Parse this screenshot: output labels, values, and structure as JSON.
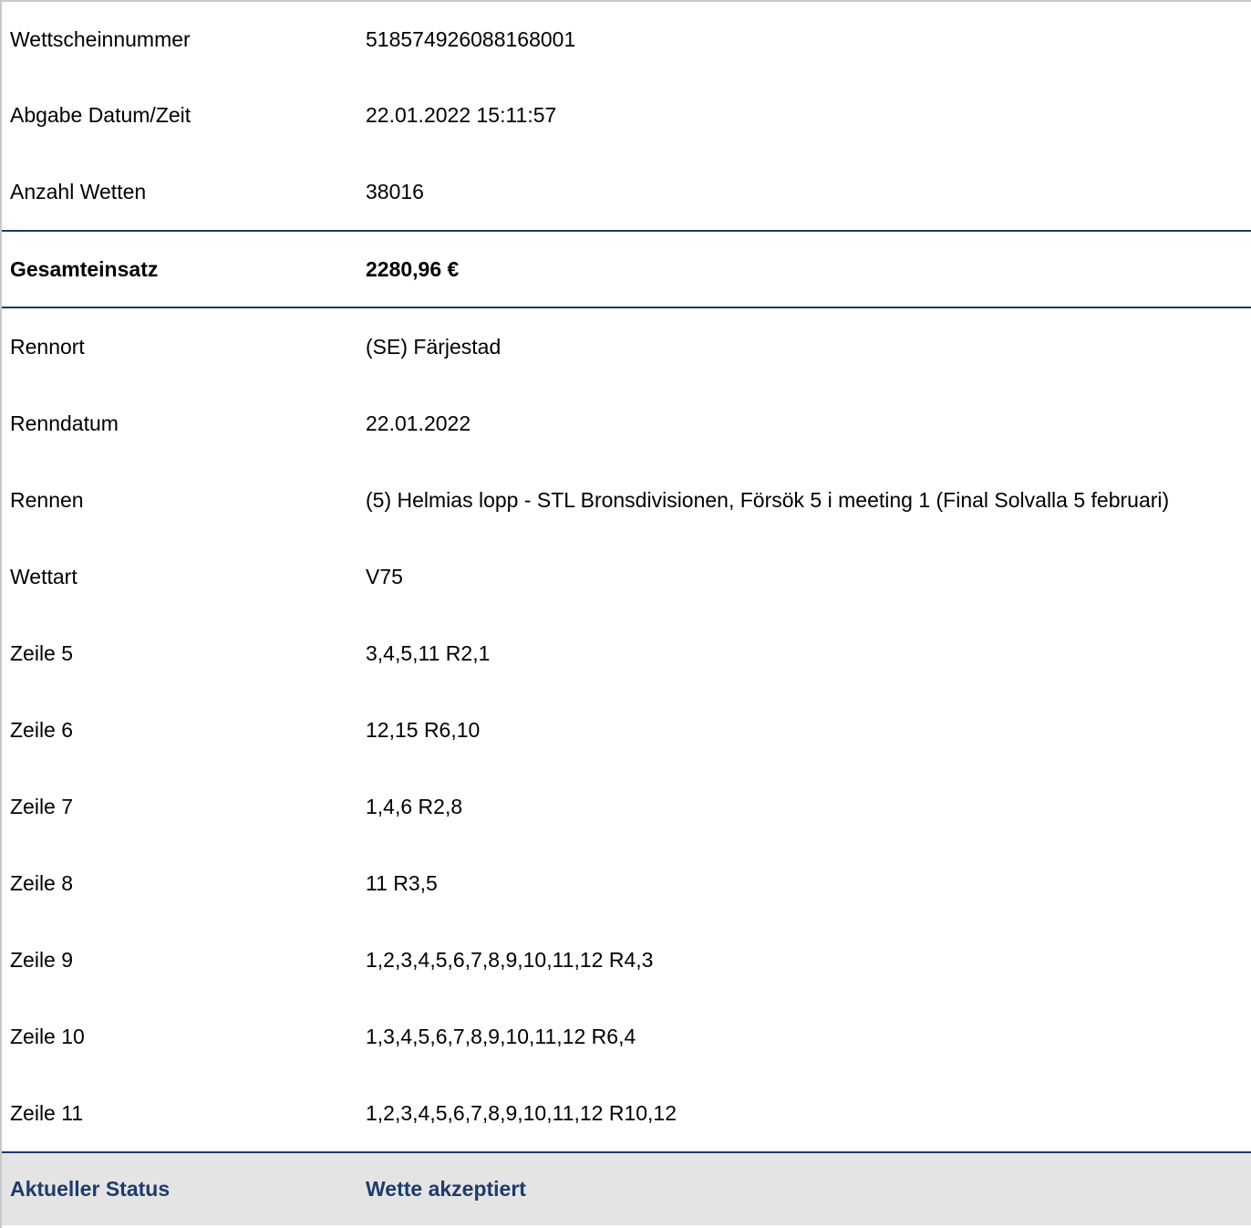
{
  "header_rows": [
    {
      "label": "Wettscheinnummer",
      "value": "518574926088168001"
    },
    {
      "label": "Abgabe Datum/Zeit",
      "value": "22.01.2022 15:11:57"
    },
    {
      "label": "Anzahl Wetten",
      "value": "38016"
    }
  ],
  "total": {
    "label": "Gesamteinsatz",
    "value": "2280,96 €"
  },
  "detail_rows": [
    {
      "label": "Rennort",
      "value": "(SE) Färjestad"
    },
    {
      "label": "Renndatum",
      "value": "22.01.2022"
    },
    {
      "label": "Rennen",
      "value": "(5) Helmias lopp - STL Bronsdivisionen, Försök 5 i meeting 1 (Final Solvalla 5 februari)"
    },
    {
      "label": "Wettart",
      "value": "V75"
    },
    {
      "label": "Zeile 5",
      "value": "3,4,5,11 R2,1"
    },
    {
      "label": "Zeile 6",
      "value": "12,15 R6,10"
    },
    {
      "label": "Zeile 7",
      "value": "1,4,6 R2,8"
    },
    {
      "label": "Zeile 8",
      "value": "11 R3,5"
    },
    {
      "label": "Zeile 9",
      "value": "1,2,3,4,5,6,7,8,9,10,11,12 R4,3"
    },
    {
      "label": "Zeile 10",
      "value": "1,3,4,5,6,7,8,9,10,11,12 R6,4"
    },
    {
      "label": "Zeile 11",
      "value": "1,2,3,4,5,6,7,8,9,10,11,12 R10,12"
    }
  ],
  "status": {
    "label": "Aktueller Status",
    "value": "Wette akzeptiert"
  },
  "colors": {
    "accent": "#1f3a6b",
    "status_background": "#e4e4e4",
    "outer_border": "#c8c8c8"
  }
}
